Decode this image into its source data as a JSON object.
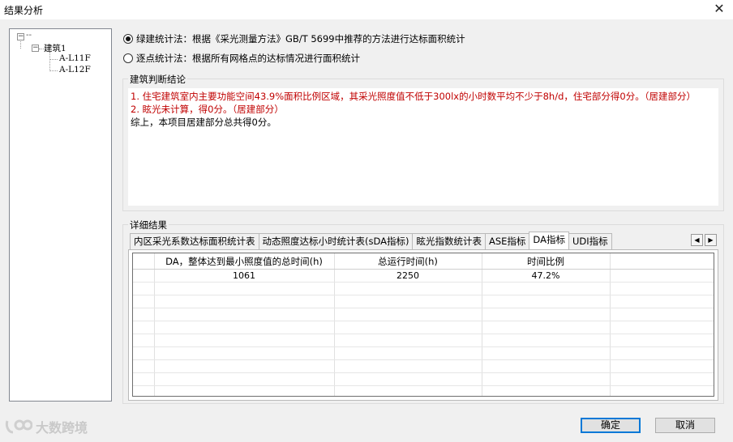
{
  "window": {
    "title": "结果分析",
    "close_glyph": "✕"
  },
  "tree": {
    "expander_glyph": "−",
    "root_label": "--",
    "building": "建筑1",
    "floors": [
      "A-L11F",
      "A-L12F"
    ]
  },
  "methods": {
    "green": "绿建统计法：根据《采光测量方法》GB/T 5699中推荐的方法进行达标面积统计",
    "point": "逐点统计法：根据所有网格点的达标情况进行面积统计",
    "selected": "green"
  },
  "conclusion": {
    "group_label": "建筑判断结论",
    "lines": [
      {
        "text": "1. 住宅建筑室内主要功能空间43.9%面积比例区域，其采光照度值不低于300lx的小时数平均不少于8h/d，住宅部分得0分。（居建部分）",
        "color": "#c00000"
      },
      {
        "text": "2. 眩光未计算，得0分。（居建部分）",
        "color": "#c00000"
      },
      {
        "text": "综上，本项目居建部分总共得0分。",
        "color": "#000000"
      }
    ]
  },
  "details": {
    "group_label": "详细结果",
    "tabs": [
      "内区采光系数达标面积统计表",
      "动态照度达标小时统计表(sDA指标)",
      "眩光指数统计表",
      "ASE指标",
      "DA指标",
      "UDI指标"
    ],
    "active_tab": 4,
    "scroll_left": "◀",
    "scroll_right": "▶",
    "table": {
      "columns": [
        "DA，整体达到最小照度值的总时间(h)",
        "总运行时间(h)",
        "时间比例"
      ],
      "rows": [
        [
          "1061",
          "2250",
          "47.2%"
        ]
      ]
    }
  },
  "buttons": {
    "ok": "确定",
    "cancel": "取消"
  },
  "watermark": {
    "text": "大数跨境"
  }
}
